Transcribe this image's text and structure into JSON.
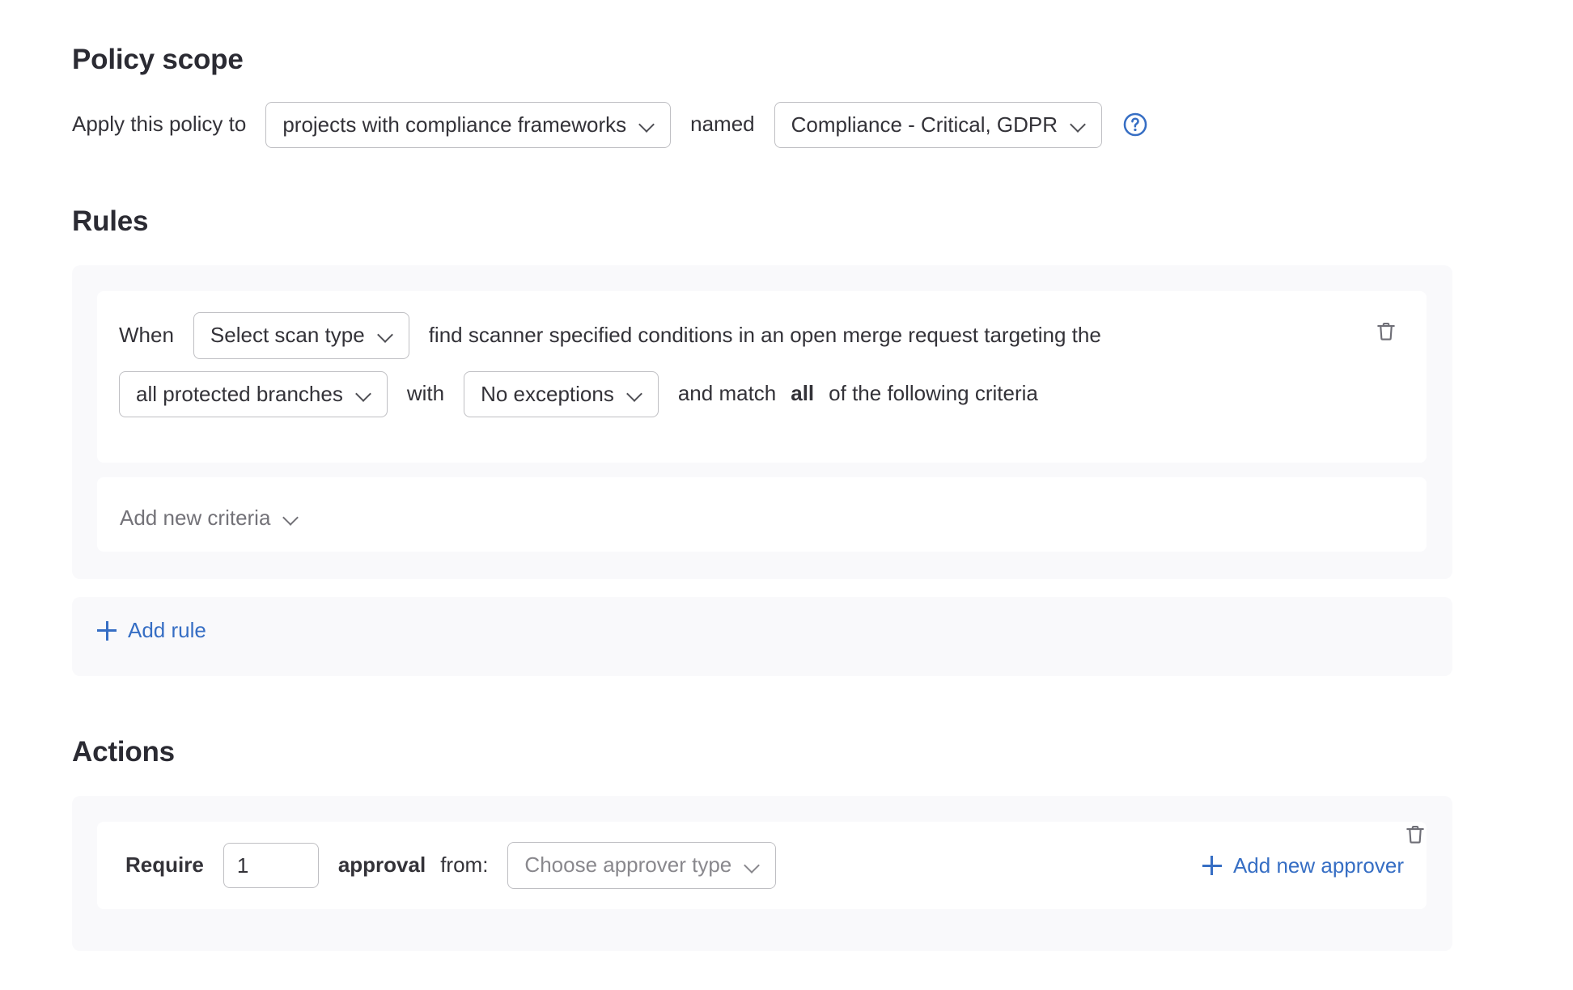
{
  "policy_scope": {
    "heading": "Policy scope",
    "apply_label": "Apply this policy to",
    "scope_type": "projects with compliance frameworks",
    "named_label": "named",
    "framework_value": "Compliance - Critical, GDPR",
    "help_icon": "question-circle-icon"
  },
  "rules": {
    "heading": "Rules",
    "rule": {
      "when_label": "When",
      "scan_type": "Select scan type",
      "condition_text": "find scanner specified conditions in an open merge request targeting the",
      "branches": "all protected branches",
      "with_label": "with",
      "exceptions": "No exceptions",
      "match_prefix": "and match",
      "match_operator": "all",
      "match_suffix": "of the following criteria",
      "delete_icon": "trash-icon"
    },
    "add_criteria_label": "Add new criteria",
    "add_rule_label": "Add rule",
    "add_rule_icon": "plus-icon"
  },
  "actions": {
    "heading": "Actions",
    "action": {
      "require_label": "Require",
      "approvals_count": "1",
      "approval_label": "approval",
      "from_label": "from:",
      "approver_type": "Choose approver type",
      "add_approver_label": "Add new approver",
      "add_approver_icon": "plus-icon",
      "delete_icon": "trash-icon"
    }
  },
  "colors": {
    "accent_link": "#366ec4",
    "text_primary": "#333238",
    "text_muted": "#89888d",
    "card_bg": "#f9f9fb",
    "border": "#bfbfc3"
  }
}
